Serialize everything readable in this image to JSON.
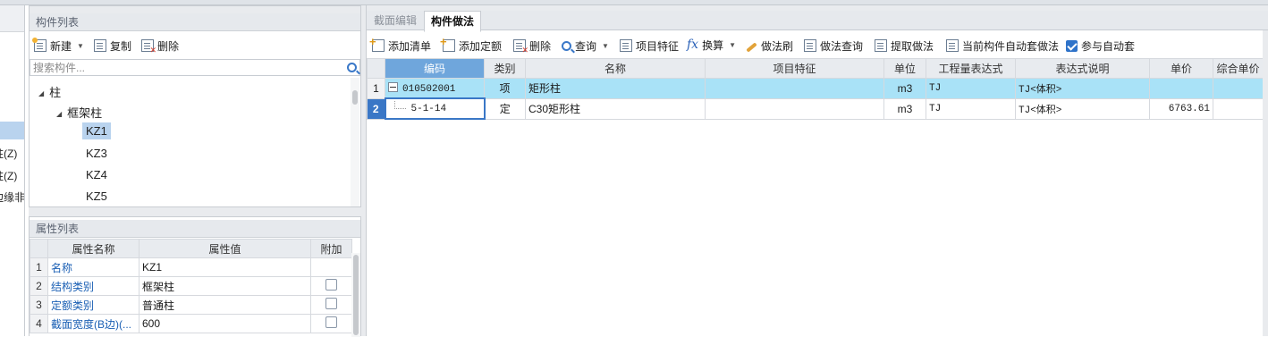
{
  "left_stub": {
    "items": [
      "柱(Z)",
      "柱(Z)",
      "边缘非"
    ]
  },
  "component_list": {
    "title": "构件列表",
    "toolbar": {
      "new_label": "新建",
      "copy_label": "复制",
      "delete_label": "删除"
    },
    "search_placeholder": "搜索构件...",
    "tree": {
      "root": "柱",
      "group": "框架柱",
      "items": [
        "KZ1",
        "KZ3",
        "KZ4",
        "KZ5"
      ],
      "selected": "KZ1"
    }
  },
  "property_list": {
    "title": "属性列表",
    "columns": [
      "属性名称",
      "属性值",
      "附加"
    ],
    "rows": [
      {
        "idx": "1",
        "name": "名称",
        "value": "KZ1"
      },
      {
        "idx": "2",
        "name": "结构类别",
        "value": "框架柱"
      },
      {
        "idx": "3",
        "name": "定额类别",
        "value": "普通柱"
      },
      {
        "idx": "4",
        "name": "截面宽度(B边)(...",
        "value": "600"
      }
    ]
  },
  "tabs": {
    "section_edit": "截面编辑",
    "component_method": "构件做法"
  },
  "method_toolbar": {
    "add_bill": "添加清单",
    "add_quota": "添加定额",
    "delete": "删除",
    "query": "查询",
    "item_feature": "项目特征",
    "convert": "换算",
    "method_brush": "做法刷",
    "method_query": "做法查询",
    "extract_method": "提取做法",
    "auto_apply_current": "当前构件自动套做法",
    "participate_auto": "参与自动套",
    "participate_auto_checked": true
  },
  "grid": {
    "columns": [
      "编码",
      "类别",
      "名称",
      "项目特征",
      "单位",
      "工程量表达式",
      "表达式说明",
      "单价",
      "综合单价"
    ],
    "rows": [
      {
        "idx": "1",
        "code": "010502001",
        "type": "项",
        "name": "矩形柱",
        "feature": "",
        "unit": "m3",
        "expr": "TJ",
        "expr_desc": "TJ<体积>",
        "price": "",
        "total": ""
      },
      {
        "idx": "2",
        "code": "5-1-14",
        "type": "定",
        "name": "C30矩形柱",
        "feature": "",
        "unit": "m3",
        "expr": "TJ",
        "expr_desc": "TJ<体积>",
        "price": "6763.61",
        "total": ""
      }
    ]
  },
  "colors": {
    "accent": "#3a77c6",
    "row_highlight": "#a9e2f7",
    "header_highlight": "#6fa6dc",
    "selection": "#b9d3ee"
  }
}
